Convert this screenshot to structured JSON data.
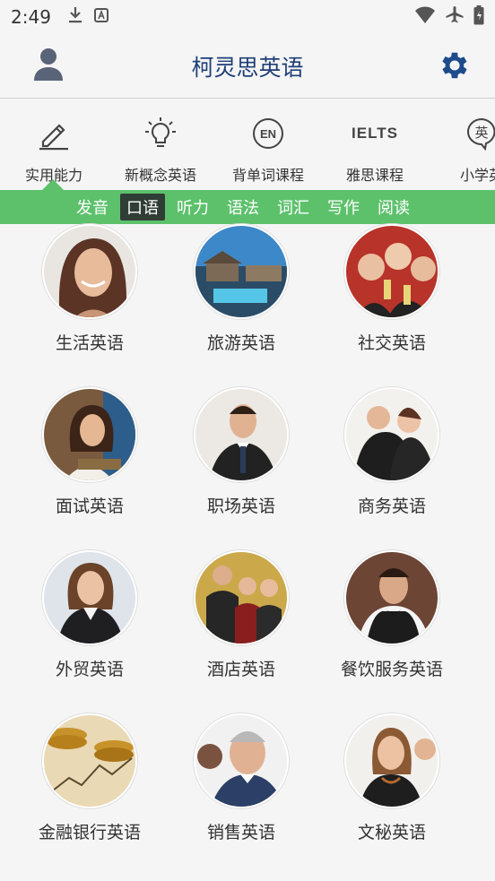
{
  "status_bar": {
    "time": "2:49"
  },
  "header": {
    "title": "柯灵思英语"
  },
  "categories": [
    {
      "label": "实用能力",
      "icon": "pencil-icon"
    },
    {
      "label": "新概念英语",
      "icon": "lightbulb-icon"
    },
    {
      "label": "背单词课程",
      "icon": "en-badge-icon",
      "icon_text": "EN"
    },
    {
      "label": "雅思课程",
      "icon": "ielts-logo-icon",
      "icon_text": "IELTS"
    },
    {
      "label": "小学英",
      "icon": "chinese-bubble-icon",
      "icon_text": "英"
    }
  ],
  "sub_tabs": [
    {
      "label": "发音",
      "active": false
    },
    {
      "label": "口语",
      "active": true
    },
    {
      "label": "听力",
      "active": false
    },
    {
      "label": "语法",
      "active": false
    },
    {
      "label": "词汇",
      "active": false
    },
    {
      "label": "写作",
      "active": false
    },
    {
      "label": "阅读",
      "active": false
    }
  ],
  "topics": [
    {
      "label": "生活英语",
      "image": "smiling-woman-photo"
    },
    {
      "label": "旅游英语",
      "image": "resort-pool-photo"
    },
    {
      "label": "社交英语",
      "image": "party-friends-photo"
    },
    {
      "label": "面试英语",
      "image": "woman-reading-photo"
    },
    {
      "label": "职场英语",
      "image": "businessman-photo"
    },
    {
      "label": "商务英语",
      "image": "business-couple-photo"
    },
    {
      "label": "外贸英语",
      "image": "businesswoman-photo"
    },
    {
      "label": "酒店英语",
      "image": "hotel-staff-photo"
    },
    {
      "label": "餐饮服务英语",
      "image": "waiter-photo"
    },
    {
      "label": "金融银行英语",
      "image": "gold-coins-photo"
    },
    {
      "label": "销售英语",
      "image": "salesman-photo"
    },
    {
      "label": "文秘英语",
      "image": "secretary-photo"
    }
  ],
  "colors": {
    "accent_green": "#5dc16c",
    "title_blue": "#1f3f77",
    "active_tab_bg": "#2f3d35"
  }
}
